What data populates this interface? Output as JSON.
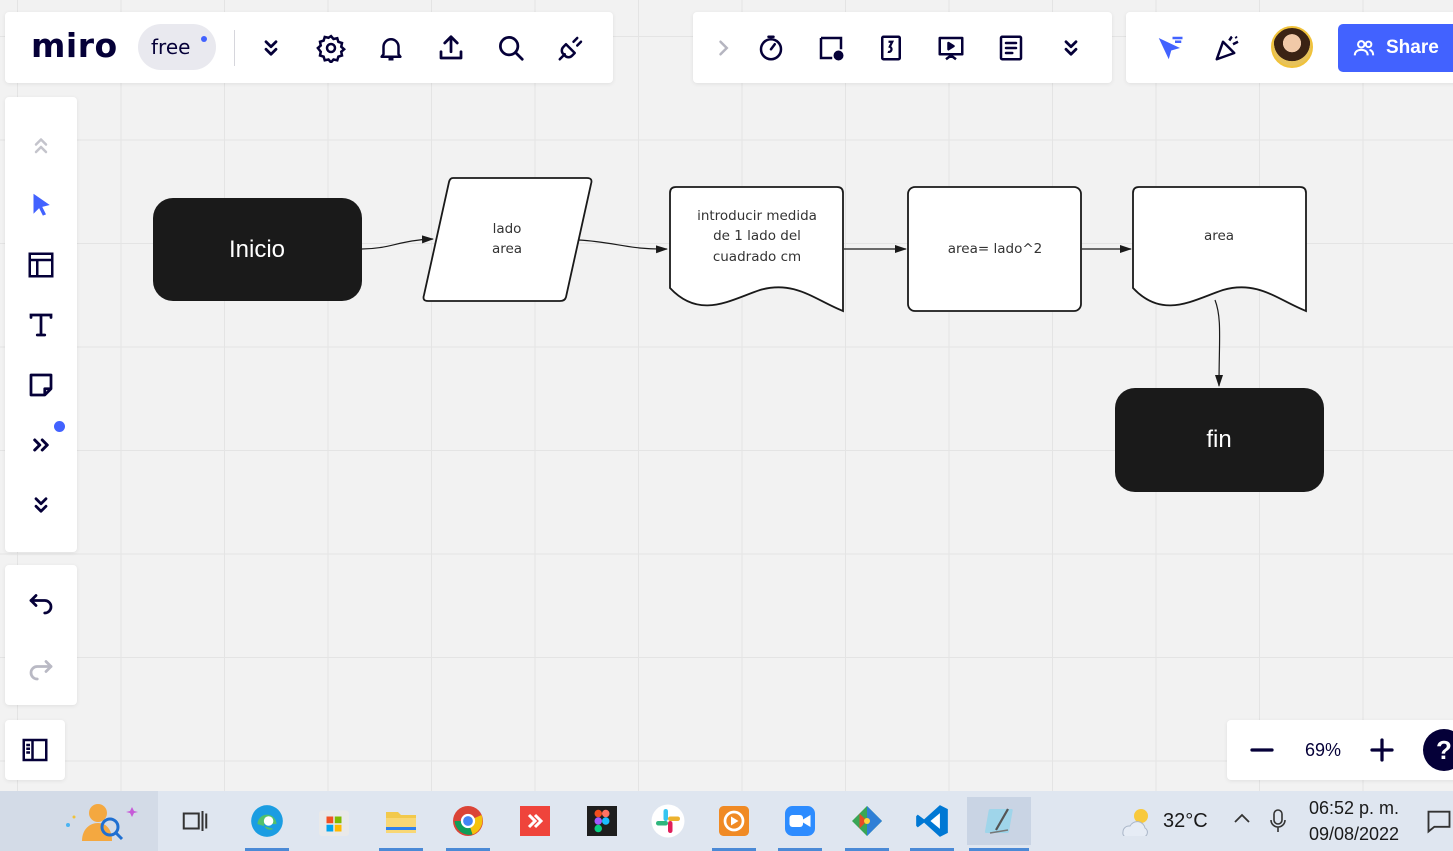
{
  "app": {
    "logo": "miro",
    "plan": "free"
  },
  "top_left_toolbar": [
    "more-tools-icon",
    "settings-icon",
    "notifications-icon",
    "export-icon",
    "search-icon",
    "integrations-icon"
  ],
  "top_mid_toolbar": [
    "collapse-chevron-icon",
    "timer-icon",
    "video-record-icon",
    "voting-icon",
    "presentation-icon",
    "notes-icon",
    "more-chevron-icon"
  ],
  "top_right": {
    "share_label": "Share"
  },
  "left_toolbar": [
    "collapse-up-icon",
    "select-icon",
    "templates-icon",
    "text-icon",
    "sticky-note-icon",
    "more-apps-icon",
    "expand-icon"
  ],
  "zoom": {
    "level": "69%"
  },
  "help": "?",
  "flowchart": {
    "start": "Inicio",
    "input_line1": "lado",
    "input_line2": "area",
    "doc1_line1": "introducir medida",
    "doc1_line2": "de 1 lado del",
    "doc1_line3": "cuadrado cm",
    "process": "area= lado^2",
    "doc2": "area",
    "end": "fin"
  },
  "taskbar": {
    "temperature": "32°C",
    "time": "06:52 p. m.",
    "date": "09/08/2022"
  }
}
